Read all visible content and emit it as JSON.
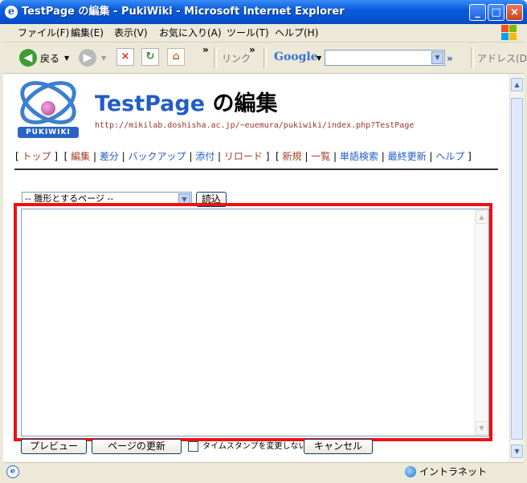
{
  "window": {
    "title": "TestPage の編集 - PukiWiki - Microsoft Internet Explorer",
    "icon": "ie-icon",
    "controls": [
      "minimize",
      "maximize",
      "close"
    ]
  },
  "menubar": {
    "items": [
      "ファイル(F)",
      "編集(E)",
      "表示(V)",
      "お気に入り(A)",
      "ツール(T)",
      "ヘルプ(H)"
    ]
  },
  "toolbar": {
    "back_label": "戻る",
    "more_chevron": "»",
    "links_label": "リンク",
    "google_label": "Google",
    "google_search_value": "",
    "address_label": "アドレス(D)"
  },
  "page": {
    "logo_text": "PUKIWIKI",
    "title_page": "TestPage",
    "title_suffix": "の編集",
    "url": "http://mikilab.doshisha.ac.jp/~euemura/pukiwiki/index.php?TestPage",
    "nav": {
      "group1": [
        "トップ"
      ],
      "group2": [
        "編集",
        "差分",
        "バックアップ",
        "添付",
        "リロード"
      ],
      "group3": [
        "新規",
        "一覧",
        "単語検索",
        "最終更新",
        "ヘルプ"
      ]
    },
    "template_select": "-- 雛形とするページ --",
    "load_button": "読込",
    "textarea_value": "",
    "preview_button": "プレビュー",
    "update_button": "ページの更新",
    "timestamp_label": "タイムスタンプを変更しない",
    "timestamp_checked": false,
    "cancel_button": "キャンセル"
  },
  "status": {
    "zone": "イントラネット"
  },
  "colors": {
    "titlebar": "#0a5bdc",
    "title_link": "#215dc6",
    "highlight": "#e11111",
    "nav_link": "#215dc6",
    "nav_visited": "#a63d21"
  }
}
